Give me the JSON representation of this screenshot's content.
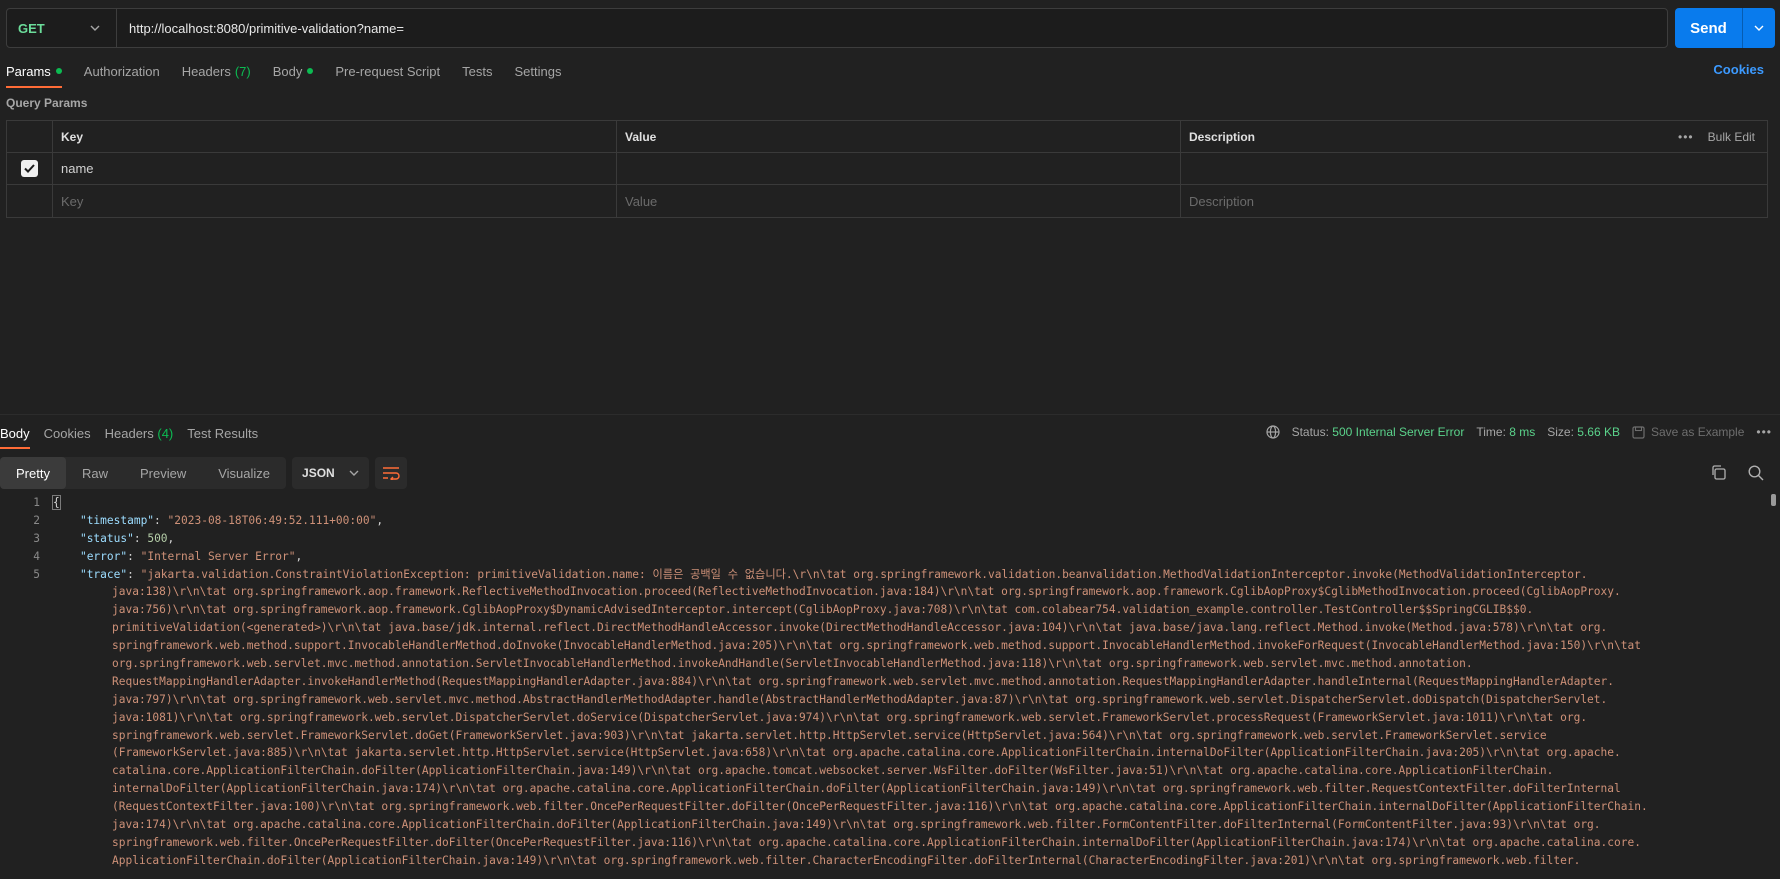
{
  "request": {
    "method": "GET",
    "url": "http://localhost:8080/primitive-validation?name=",
    "send_label": "Send"
  },
  "req_tabs": {
    "params": "Params",
    "authorization": "Authorization",
    "headers": "Headers",
    "headers_count": "(7)",
    "body": "Body",
    "pre_request": "Pre-request Script",
    "tests": "Tests",
    "settings": "Settings",
    "cookies": "Cookies"
  },
  "query_params": {
    "label": "Query Params",
    "columns": [
      "Key",
      "Value",
      "Description"
    ],
    "bulk_edit": "Bulk Edit",
    "rows": [
      {
        "checked": true,
        "key": "name",
        "value": "",
        "description": ""
      }
    ],
    "placeholders": {
      "key": "Key",
      "value": "Value",
      "description": "Description"
    }
  },
  "response": {
    "tabs": {
      "body": "Body",
      "cookies": "Cookies",
      "headers": "Headers",
      "headers_count": "(4)",
      "test_results": "Test Results"
    },
    "status_label": "Status:",
    "status_value": "500 Internal Server Error",
    "time_label": "Time:",
    "time_value": "8 ms",
    "size_label": "Size:",
    "size_value": "5.66 KB",
    "save_example": "Save as Example",
    "views": [
      "Pretty",
      "Raw",
      "Preview",
      "Visualize"
    ],
    "format": "JSON",
    "line_numbers": [
      "1",
      "2",
      "3",
      "4",
      "5"
    ],
    "json": {
      "open": "{",
      "timestamp_key": "\"timestamp\"",
      "timestamp_val": "\"2023-08-18T06:49:52.111+00:00\"",
      "status_key": "\"status\"",
      "status_val": "500",
      "error_key": "\"error\"",
      "error_val": "\"Internal Server Error\"",
      "trace_key": "\"trace\"",
      "trace_lines": [
        "\"jakarta.validation.ConstraintViolationException: primitiveValidation.name: 이름은 공백일 수 없습니다.\\r\\n\\tat org.springframework.validation.beanvalidation.MethodValidationInterceptor.invoke(MethodValidationInterceptor.",
        "java:138)\\r\\n\\tat org.springframework.aop.framework.ReflectiveMethodInvocation.proceed(ReflectiveMethodInvocation.java:184)\\r\\n\\tat org.springframework.aop.framework.CglibAopProxy$CglibMethodInvocation.proceed(CglibAopProxy.",
        "java:756)\\r\\n\\tat org.springframework.aop.framework.CglibAopProxy$DynamicAdvisedInterceptor.intercept(CglibAopProxy.java:708)\\r\\n\\tat com.colabear754.validation_example.controller.TestController$$SpringCGLIB$$0.",
        "primitiveValidation(<generated>)\\r\\n\\tat java.base/jdk.internal.reflect.DirectMethodHandleAccessor.invoke(DirectMethodHandleAccessor.java:104)\\r\\n\\tat java.base/java.lang.reflect.Method.invoke(Method.java:578)\\r\\n\\tat org.",
        "springframework.web.method.support.InvocableHandlerMethod.doInvoke(InvocableHandlerMethod.java:205)\\r\\n\\tat org.springframework.web.method.support.InvocableHandlerMethod.invokeForRequest(InvocableHandlerMethod.java:150)\\r\\n\\tat",
        "org.springframework.web.servlet.mvc.method.annotation.ServletInvocableHandlerMethod.invokeAndHandle(ServletInvocableHandlerMethod.java:118)\\r\\n\\tat org.springframework.web.servlet.mvc.method.annotation.",
        "RequestMappingHandlerAdapter.invokeHandlerMethod(RequestMappingHandlerAdapter.java:884)\\r\\n\\tat org.springframework.web.servlet.mvc.method.annotation.RequestMappingHandlerAdapter.handleInternal(RequestMappingHandlerAdapter.",
        "java:797)\\r\\n\\tat org.springframework.web.servlet.mvc.method.AbstractHandlerMethodAdapter.handle(AbstractHandlerMethodAdapter.java:87)\\r\\n\\tat org.springframework.web.servlet.DispatcherServlet.doDispatch(DispatcherServlet.",
        "java:1081)\\r\\n\\tat org.springframework.web.servlet.DispatcherServlet.doService(DispatcherServlet.java:974)\\r\\n\\tat org.springframework.web.servlet.FrameworkServlet.processRequest(FrameworkServlet.java:1011)\\r\\n\\tat org.",
        "springframework.web.servlet.FrameworkServlet.doGet(FrameworkServlet.java:903)\\r\\n\\tat jakarta.servlet.http.HttpServlet.service(HttpServlet.java:564)\\r\\n\\tat org.springframework.web.servlet.FrameworkServlet.service",
        "(FrameworkServlet.java:885)\\r\\n\\tat jakarta.servlet.http.HttpServlet.service(HttpServlet.java:658)\\r\\n\\tat org.apache.catalina.core.ApplicationFilterChain.internalDoFilter(ApplicationFilterChain.java:205)\\r\\n\\tat org.apache.",
        "catalina.core.ApplicationFilterChain.doFilter(ApplicationFilterChain.java:149)\\r\\n\\tat org.apache.tomcat.websocket.server.WsFilter.doFilter(WsFilter.java:51)\\r\\n\\tat org.apache.catalina.core.ApplicationFilterChain.",
        "internalDoFilter(ApplicationFilterChain.java:174)\\r\\n\\tat org.apache.catalina.core.ApplicationFilterChain.doFilter(ApplicationFilterChain.java:149)\\r\\n\\tat org.springframework.web.filter.RequestContextFilter.doFilterInternal",
        "(RequestContextFilter.java:100)\\r\\n\\tat org.springframework.web.filter.OncePerRequestFilter.doFilter(OncePerRequestFilter.java:116)\\r\\n\\tat org.apache.catalina.core.ApplicationFilterChain.internalDoFilter(ApplicationFilterChain.",
        "java:174)\\r\\n\\tat org.apache.catalina.core.ApplicationFilterChain.doFilter(ApplicationFilterChain.java:149)\\r\\n\\tat org.springframework.web.filter.FormContentFilter.doFilterInternal(FormContentFilter.java:93)\\r\\n\\tat org.",
        "springframework.web.filter.OncePerRequestFilter.doFilter(OncePerRequestFilter.java:116)\\r\\n\\tat org.apache.catalina.core.ApplicationFilterChain.internalDoFilter(ApplicationFilterChain.java:174)\\r\\n\\tat org.apache.catalina.core.",
        "ApplicationFilterChain.doFilter(ApplicationFilterChain.java:149)\\r\\n\\tat org.springframework.web.filter.CharacterEncodingFilter.doFilterInternal(CharacterEncodingFilter.java:201)\\r\\n\\tat org.springframework.web.filter."
      ]
    }
  },
  "colors": {
    "accent": "#ff6c37",
    "send": "#097bed",
    "method": "#6bdd9a",
    "status_ok_green": "#5bd38b",
    "link": "#3c9aff"
  },
  "icons": [
    "chevron-down-icon",
    "checkmark-icon",
    "more-icon",
    "globe-icon",
    "save-icon",
    "wrap-lines-icon",
    "copy-icon",
    "search-icon"
  ]
}
